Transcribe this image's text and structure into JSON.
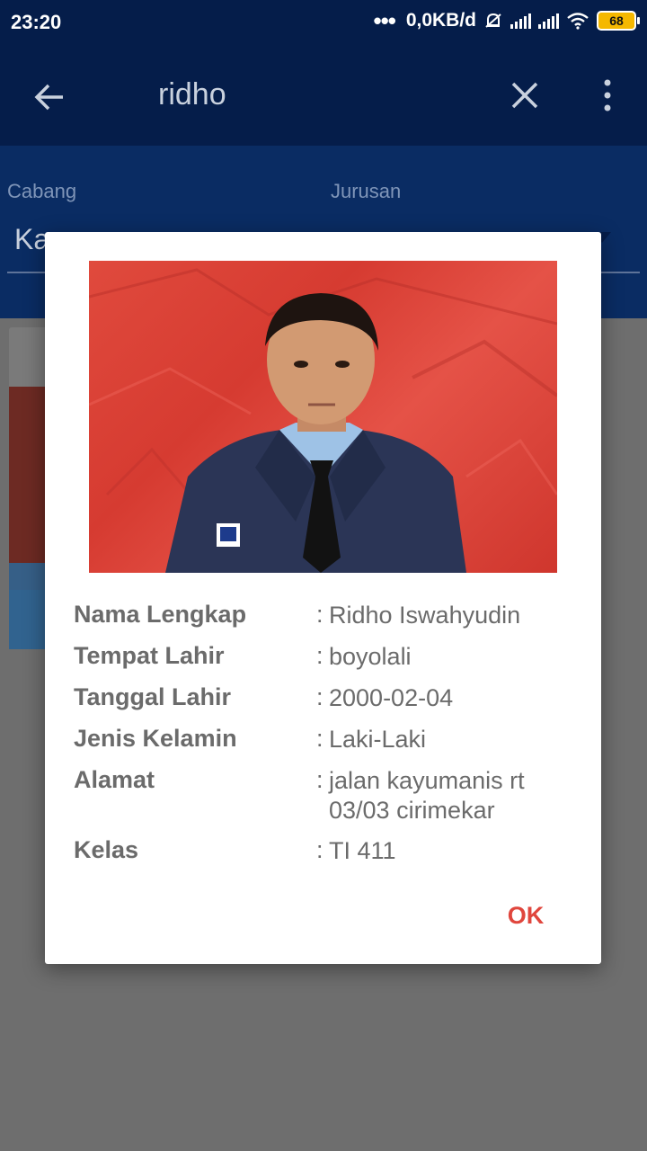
{
  "status_bar": {
    "time": "23:20",
    "network_speed": "0,0KB/d",
    "battery_level": "68"
  },
  "toolbar": {
    "search_query": "ridho"
  },
  "filters": {
    "cabang_label": "Cabang",
    "cabang_value": "Ka",
    "jurusan_label": "Jurusan",
    "jurusan_value": ""
  },
  "dialog": {
    "fields": [
      {
        "label": "Nama Lengkap",
        "value": "Ridho Iswahyudin"
      },
      {
        "label": "Tempat Lahir",
        "value": "boyolali"
      },
      {
        "label": "Tanggal Lahir",
        "value": "2000-02-04"
      },
      {
        "label": "Jenis Kelamin",
        "value": "Laki-Laki"
      },
      {
        "label": "Alamat",
        "value": "jalan kayumanis rt 03/03 cirimekar"
      },
      {
        "label": "Kelas",
        "value": "TI 411"
      }
    ],
    "colon": ":",
    "ok_label": "OK"
  },
  "colors": {
    "app_bar": "#051d4a",
    "filter_bg": "#0a2c63",
    "ok_accent": "#e0463d",
    "photo_bg": "#d83e33"
  }
}
